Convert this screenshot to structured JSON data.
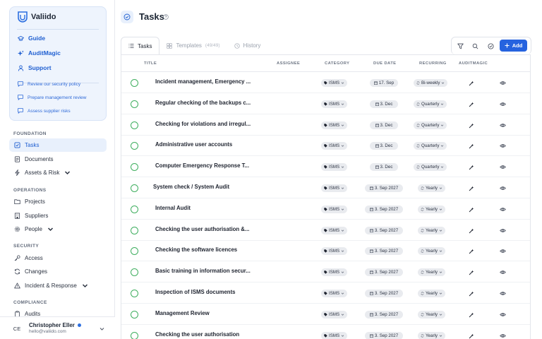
{
  "brand": {
    "name": "Valiido",
    "links": [
      {
        "label": "Guide",
        "icon": "graduation-cap-icon"
      },
      {
        "label": "AuditMagic",
        "icon": "sparkles-icon"
      },
      {
        "label": "Support",
        "icon": "person-icon"
      }
    ],
    "suggestions": [
      "Review our security policy",
      "Prepare management review",
      "Assess supplier risks"
    ]
  },
  "nav": {
    "foundation_title": "FOUNDATION",
    "foundation": [
      {
        "label": "Tasks",
        "active": true
      },
      {
        "label": "Documents"
      },
      {
        "label": "Assets & Risk"
      }
    ],
    "operations_title": "OPERATIONS",
    "operations": [
      {
        "label": "Projects"
      },
      {
        "label": "Suppliers"
      },
      {
        "label": "People"
      }
    ],
    "security_title": "SECURITY",
    "security": [
      {
        "label": "Access"
      },
      {
        "label": "Changes"
      },
      {
        "label": "Incident & Response"
      }
    ],
    "compliance_title": "COMPLIANCE",
    "compliance": [
      {
        "label": "Audits"
      }
    ]
  },
  "user": {
    "initials": "CE",
    "name": "Christopher Eller",
    "email": "hello@valiido.com"
  },
  "page": {
    "title": "Tasks",
    "tabs": [
      {
        "label": "Tasks",
        "active": true
      },
      {
        "label": "Templates",
        "count": "(49/49)"
      },
      {
        "label": "History"
      }
    ],
    "add_label": "Add"
  },
  "table": {
    "columns": [
      "TITLE",
      "ASSIGNEE",
      "CATEGORY",
      "DUE DATE",
      "RECURRING",
      "AUDITMAGIC"
    ],
    "rows": [
      {
        "title": "Incident management, Emergency ...",
        "category": "ISMS",
        "due": "17. Sep",
        "recurring": "Bi-weekly"
      },
      {
        "title": "Regular checking of the backups c...",
        "category": "ISMS",
        "due": "3. Dec",
        "recurring": "Quarterly"
      },
      {
        "title": "Checking for violations and irregul...",
        "category": "ISMS",
        "due": "3. Dec",
        "recurring": "Quarterly"
      },
      {
        "title": "Administrative user accounts",
        "category": "ISMS",
        "due": "3. Dec",
        "recurring": "Quarterly"
      },
      {
        "title": "Computer Emergency Response T...",
        "category": "ISMS",
        "due": "3. Dec",
        "recurring": "Quarterly"
      },
      {
        "title": "System check / System Audit",
        "category": "ISMS",
        "due": "3. Sep 2027",
        "recurring": "Yearly"
      },
      {
        "title": "Internal Audit",
        "category": "ISMS",
        "due": "3. Sep 2027",
        "recurring": "Yearly"
      },
      {
        "title": "Checking the user authorisation &...",
        "category": "ISMS",
        "due": "3. Sep 2027",
        "recurring": "Yearly"
      },
      {
        "title": "Checking the software licences",
        "category": "ISMS",
        "due": "3. Sep 2027",
        "recurring": "Yearly"
      },
      {
        "title": "Basic training in information secur...",
        "category": "ISMS",
        "due": "3. Sep 2027",
        "recurring": "Yearly"
      },
      {
        "title": "Inspection of ISMS documents",
        "category": "ISMS",
        "due": "3. Sep 2027",
        "recurring": "Yearly"
      },
      {
        "title": "Management Review",
        "category": "ISMS",
        "due": "3. Sep 2027",
        "recurring": "Yearly"
      },
      {
        "title": "Checking the user authorisation",
        "category": "ISMS",
        "due": "3. Sep 2027",
        "recurring": "Yearly"
      }
    ]
  },
  "colors": {
    "accent": "#2663df",
    "check": "#3fae5f",
    "chip_bg": "#e9ebef"
  }
}
